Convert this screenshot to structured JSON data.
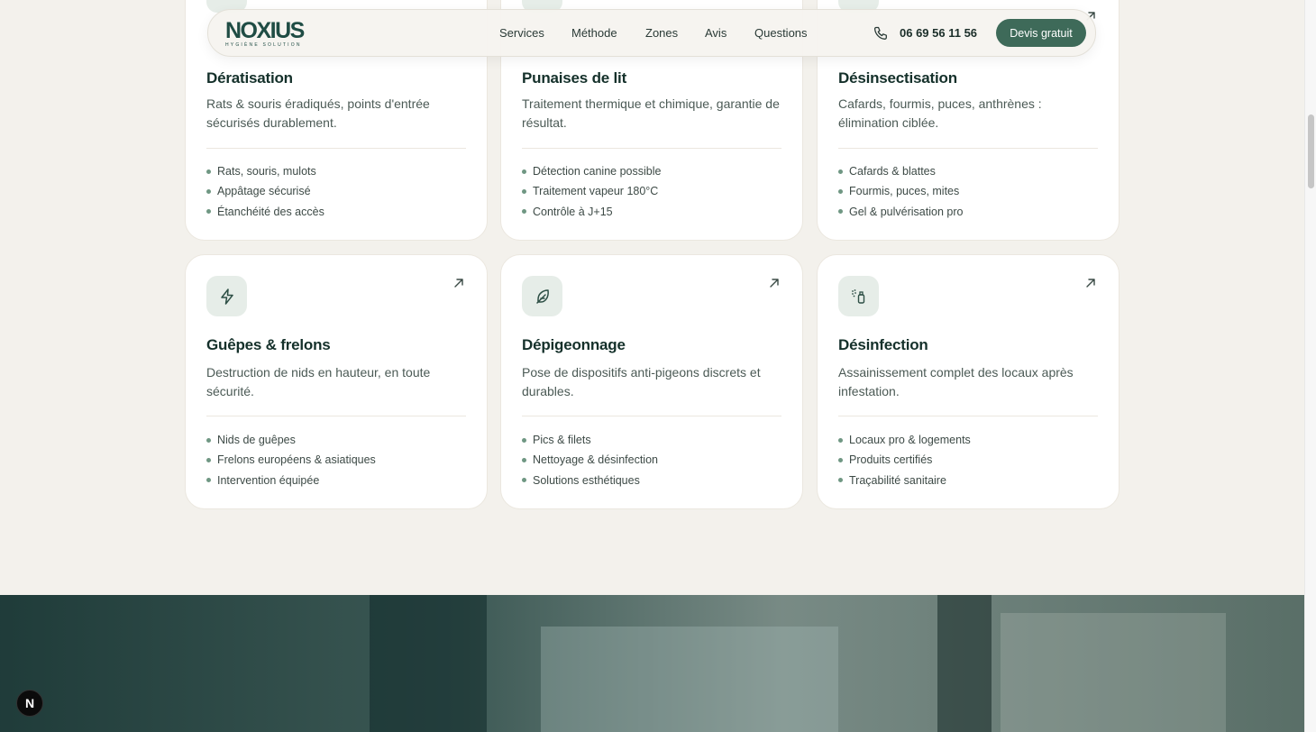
{
  "nav": {
    "logo_word": "NOXIUS",
    "logo_tagline": "HYGIÈNE SOLUTION",
    "links": [
      "Services",
      "Méthode",
      "Zones",
      "Avis",
      "Questions"
    ],
    "phone": "06 69 56 11 56",
    "cta": "Devis gratuit"
  },
  "cards": [
    {
      "icon": "rat-icon",
      "title": "Dératisation",
      "description": "Rats & souris éradiqués, points d'entrée sécurisés durablement.",
      "features": [
        "Rats, souris, mulots",
        "Appâtage sécurisé",
        "Étanchéité des accès"
      ]
    },
    {
      "icon": "bed-bug-icon",
      "title": "Punaises de lit",
      "description": "Traitement thermique et chimique, garantie de résultat.",
      "features": [
        "Détection canine possible",
        "Traitement vapeur 180°C",
        "Contrôle à J+15"
      ]
    },
    {
      "icon": "cockroach-icon",
      "title": "Désinsectisation",
      "description": "Cafards, fourmis, puces, anthrènes : élimination ciblée.",
      "features": [
        "Cafards & blattes",
        "Fourmis, puces, mites",
        "Gel & pulvérisation pro"
      ]
    },
    {
      "icon": "zap-icon",
      "title": "Guêpes & frelons",
      "description": "Destruction de nids en hauteur, en toute sécurité.",
      "features": [
        "Nids de guêpes",
        "Frelons européens & asiatiques",
        "Intervention équipée"
      ]
    },
    {
      "icon": "feather-icon",
      "title": "Dépigeonnage",
      "description": "Pose de dispositifs anti-pigeons discrets et durables.",
      "features": [
        "Pics & filets",
        "Nettoyage & désinfection",
        "Solutions esthétiques"
      ]
    },
    {
      "icon": "spray-can-icon",
      "title": "Désinfection",
      "description": "Assainissement complet des locaux après infestation.",
      "features": [
        "Locaux pro & logements",
        "Produits certifiés",
        "Traçabilité sanitaire"
      ]
    }
  ],
  "badge": "N",
  "colors": {
    "background": "#f3f1ec",
    "accent": "#3e6a59",
    "icon_tile": "#e6ede8",
    "bullet": "#6f9783"
  }
}
